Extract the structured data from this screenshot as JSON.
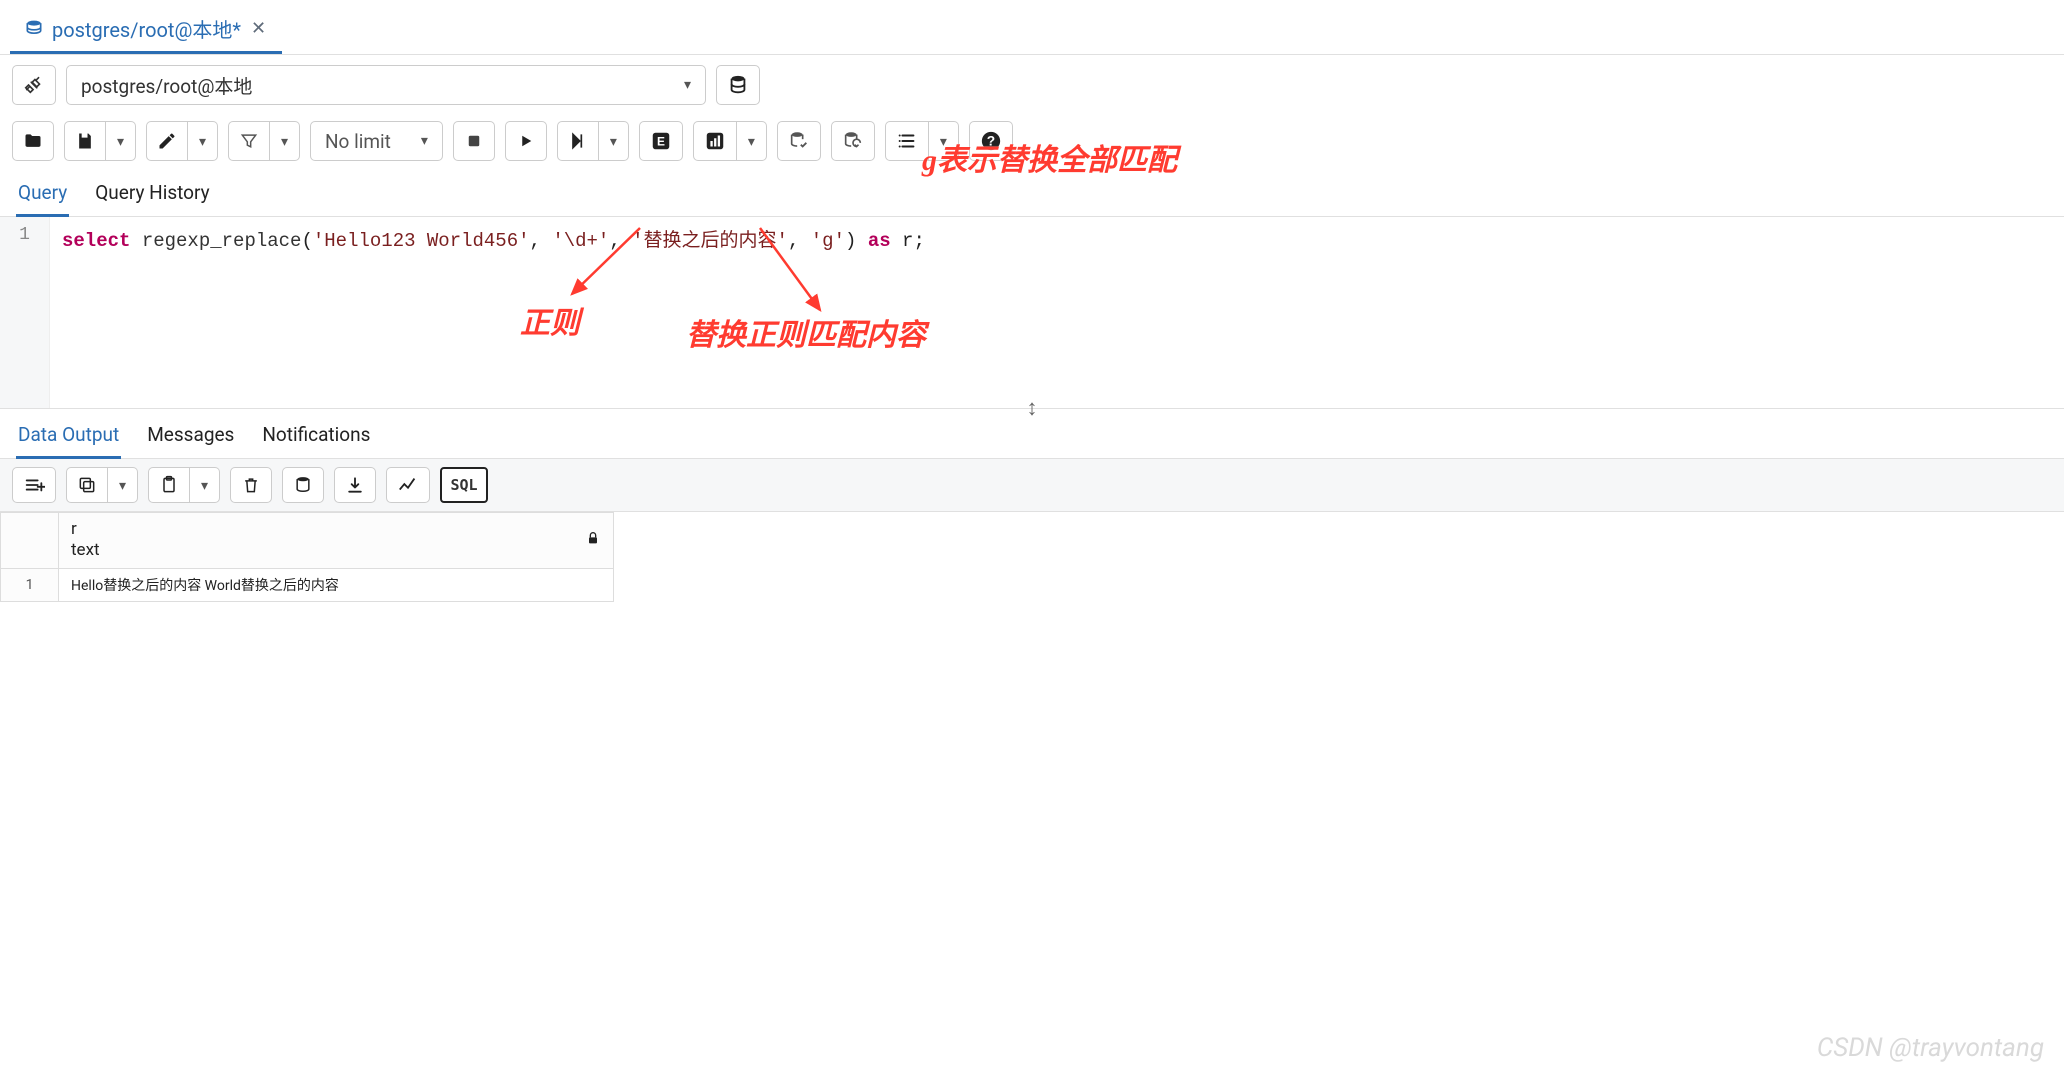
{
  "tab": {
    "title": "postgres/root@本地*",
    "close": "✕"
  },
  "connection": {
    "value": "postgres/root@本地"
  },
  "toolbar": {
    "nolimit": "No limit",
    "sql_label": "SQL"
  },
  "editor_tabs": {
    "query": "Query",
    "history": "Query History"
  },
  "code": {
    "line_no": "1",
    "kw_select": "select",
    "fn": "regexp_replace",
    "paren_open": "(",
    "arg1": "'Hello123 World456'",
    "comma1": ", ",
    "arg2": "'\\d+'",
    "comma2": ", ",
    "arg3": "'替换之后的内容'",
    "comma3": ", ",
    "arg4": "'g'",
    "paren_close": ")",
    "kw_as": "as",
    "alias": "r",
    "semi": ";"
  },
  "annotations": {
    "g_flag": "g表示替换全部匹配",
    "regex": "正则",
    "replace": "替换正则匹配内容"
  },
  "output_tabs": {
    "data": "Data Output",
    "messages": "Messages",
    "notifications": "Notifications"
  },
  "result": {
    "col_name": "r",
    "col_type": "text",
    "rownum": "1",
    "cell": "Hello替换之后的内容 World替换之后的内容"
  },
  "watermark": "CSDN @trayvontang"
}
